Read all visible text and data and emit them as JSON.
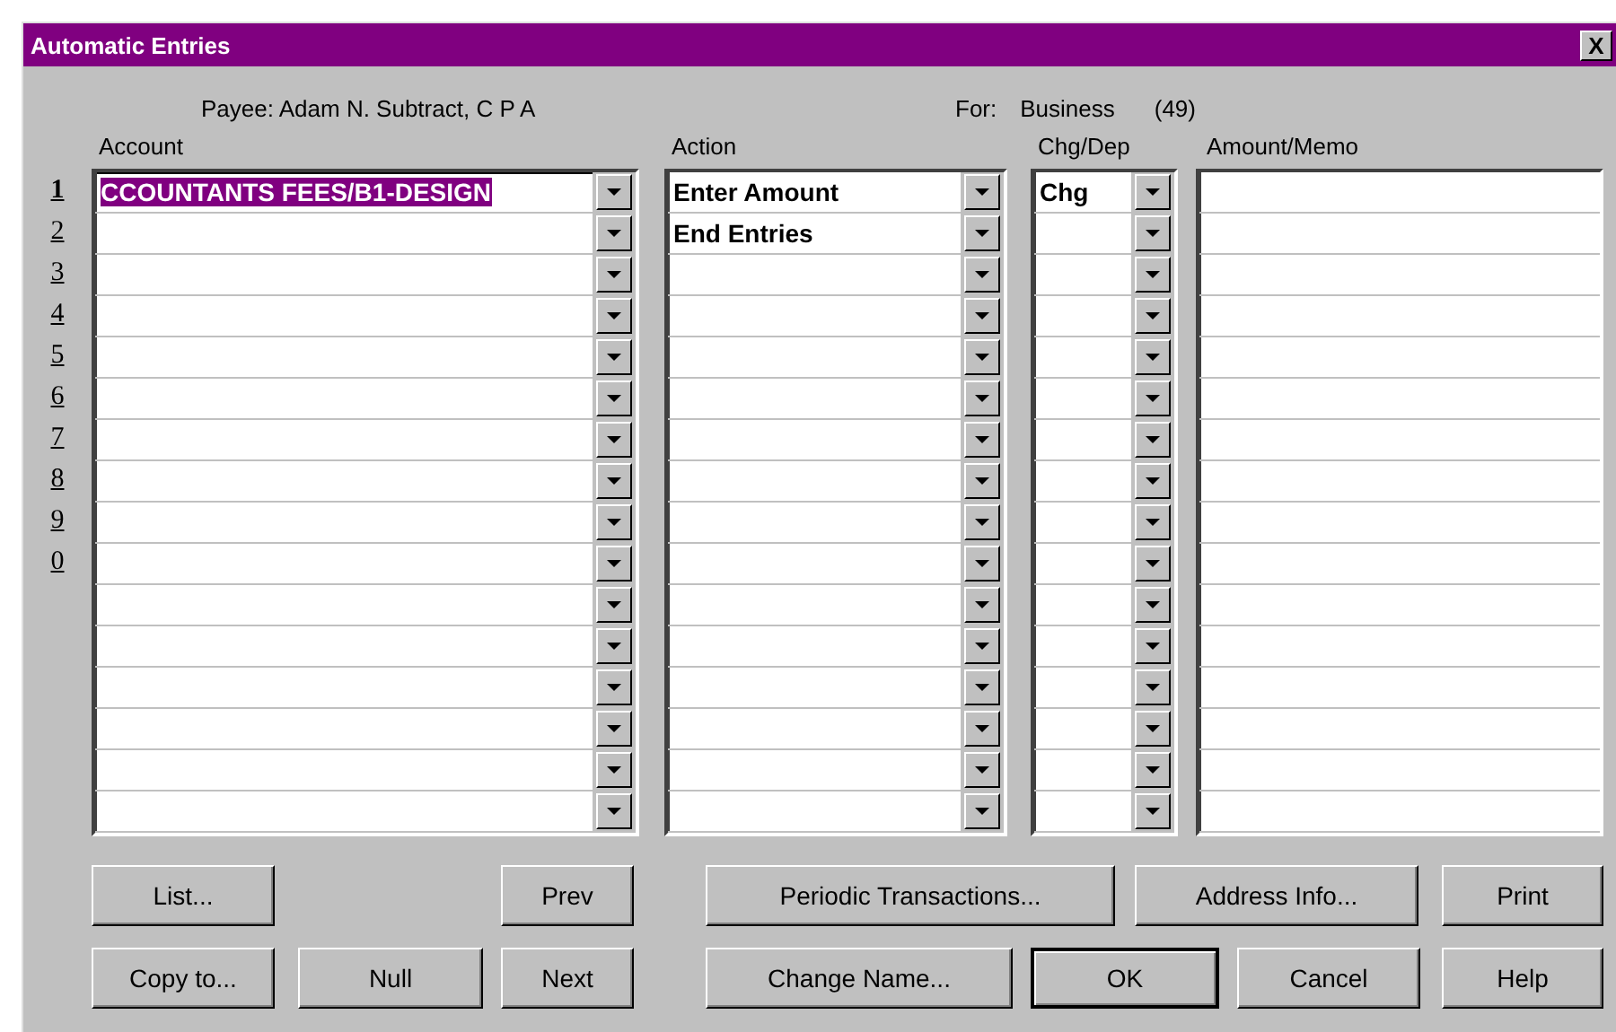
{
  "window": {
    "title": "Automatic Entries",
    "close": "X"
  },
  "header": {
    "payee": "Payee: Adam N. Subtract, C P A",
    "for_label": "For:",
    "for_value": "Business",
    "count": "(49)"
  },
  "columns": [
    "Account",
    "Action",
    "Chg/Dep",
    "Amount/Memo"
  ],
  "rows": [
    {
      "number": "1",
      "selected": true,
      "account": "CCOUNTANTS FEES/B1-DESIGN",
      "action": "Enter Amount",
      "chg_dep": "Chg"
    },
    {
      "number": "2",
      "selected": false,
      "action": "End Entries"
    },
    {
      "number": "3",
      "selected": false
    },
    {
      "number": "4",
      "selected": false
    },
    {
      "number": "5",
      "selected": false
    },
    {
      "number": "6",
      "selected": false
    },
    {
      "number": "7",
      "selected": false
    },
    {
      "number": "8",
      "selected": false
    },
    {
      "number": "9",
      "selected": false
    },
    {
      "number": "0",
      "selected": false
    },
    {
      "selected": false
    },
    {
      "selected": false
    },
    {
      "selected": false
    },
    {
      "selected": false
    },
    {
      "selected": false
    },
    {
      "selected": false
    }
  ],
  "buttons": [
    [
      {
        "label": "List...",
        "default": false
      },
      {
        "label": "Prev",
        "default": false
      },
      {
        "label": "Periodic Transactions...",
        "default": false
      },
      {
        "label": "Address Info...",
        "default": false
      },
      {
        "label": "Print",
        "default": false
      }
    ],
    [
      {
        "label": "Copy to...",
        "default": false
      },
      {
        "label": "Null",
        "default": false
      },
      {
        "label": "Next",
        "default": false
      },
      {
        "label": "Change Name...",
        "default": false
      },
      {
        "label": "OK",
        "default": true
      },
      {
        "label": "Cancel",
        "default": false
      },
      {
        "label": "Help",
        "default": false
      }
    ]
  ]
}
